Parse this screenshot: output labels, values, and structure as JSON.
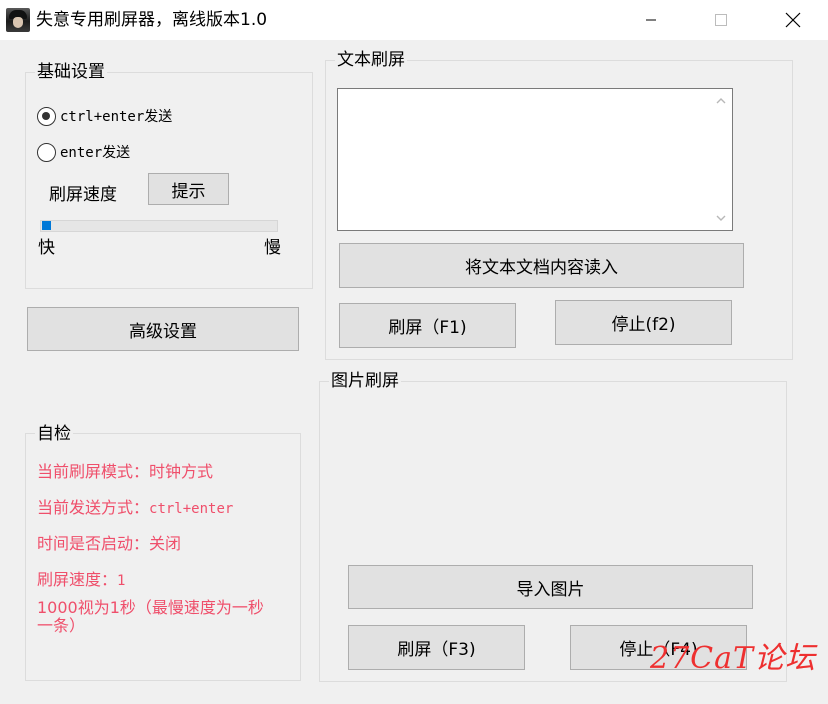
{
  "window": {
    "title": "失意专用刷屏器，离线版本1.0",
    "icons": {
      "app": "avatar-app-icon",
      "minimize": "minimize-icon",
      "maximize": "maximize-icon",
      "close": "close-icon"
    }
  },
  "basic_settings": {
    "group_label": "基础设置",
    "radio_ctrl_enter": {
      "label": "ctrl+enter发送",
      "checked": true
    },
    "radio_enter": {
      "label": "enter发送",
      "checked": false
    },
    "speed_label": "刷屏速度",
    "hint_button": "提示",
    "slider": {
      "fast_label": "快",
      "slow_label": "慢",
      "value": 0.02
    }
  },
  "advanced_button": "高级设置",
  "self_check": {
    "group_label": "自检",
    "mode_line": "当前刷屏模式：时钟方式",
    "send_line_prefix": "当前发送方式：",
    "send_line_value": "ctrl+enter",
    "timer_line": "时间是否启动：关闭",
    "speed_line_prefix": "刷屏速度：",
    "speed_line_value": "1",
    "note_line_1": "1000视为1秒（最慢速度为一秒",
    "note_line_2": "一条）"
  },
  "text_spam": {
    "group_label": "文本刷屏",
    "text_value": "",
    "load_button": "将文本文档内容读入",
    "spam_button": "刷屏（F1)",
    "stop_button": "停止(f2)"
  },
  "image_spam": {
    "group_label": "图片刷屏",
    "import_button": "导入图片",
    "spam_button": "刷屏（F3)",
    "stop_button": "停止（F4)"
  },
  "watermark": "27CaT论坛",
  "colors": {
    "window_bg": "#f0f0f0",
    "button_bg": "#e1e1e1",
    "button_border": "#adadad",
    "self_check_text": "#ef4f6b",
    "slider_accent": "#0078d7",
    "watermark": "#ee3030"
  }
}
